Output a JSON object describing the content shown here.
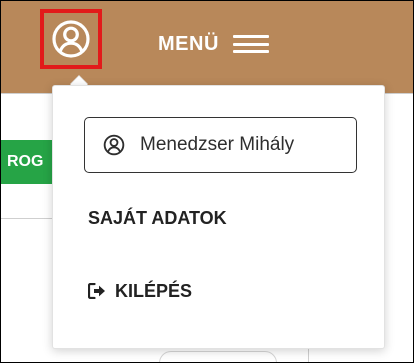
{
  "header": {
    "menu_label": "MENÜ",
    "background_color": "#b8885a",
    "highlight_color": "#e21a1a"
  },
  "background": {
    "tab_label": "ROG",
    "tab_color": "#26a446"
  },
  "dropdown": {
    "user_name": "Menedzser Mihály",
    "my_data_label": "SAJÁT ADATOK",
    "logout_label": "KILÉPÉS",
    "user_icon": "user-circle-icon",
    "logout_icon": "sign-out-icon"
  }
}
